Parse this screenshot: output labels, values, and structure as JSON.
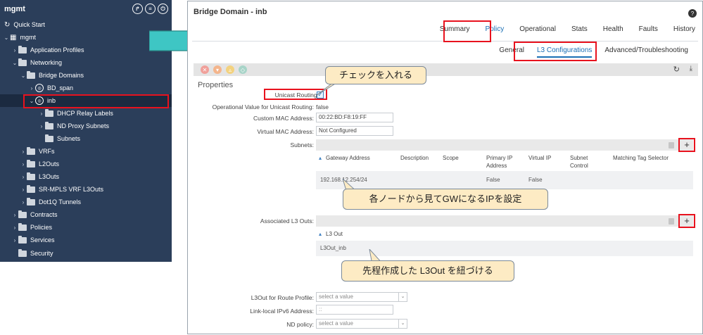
{
  "sidebar": {
    "title": "mgmt",
    "items": [
      {
        "label": "Quick Start"
      },
      {
        "label": "mgmt"
      },
      {
        "label": "Application Profiles"
      },
      {
        "label": "Networking"
      },
      {
        "label": "Bridge Domains"
      },
      {
        "label": "BD_span"
      },
      {
        "label": "inb"
      },
      {
        "label": "DHCP Relay Labels"
      },
      {
        "label": "ND Proxy Subnets"
      },
      {
        "label": "Subnets"
      },
      {
        "label": "VRFs"
      },
      {
        "label": "L2Outs"
      },
      {
        "label": "L3Outs"
      },
      {
        "label": "SR-MPLS VRF L3Outs"
      },
      {
        "label": "Dot1Q Tunnels"
      },
      {
        "label": "Contracts"
      },
      {
        "label": "Policies"
      },
      {
        "label": "Services"
      },
      {
        "label": "Security"
      }
    ]
  },
  "panel": {
    "title": "Bridge Domain - inb",
    "tabs": [
      "Summary",
      "Policy",
      "Operational",
      "Stats",
      "Health",
      "Faults",
      "History"
    ],
    "active_tab": "Policy",
    "subtabs": [
      "General",
      "L3 Configurations",
      "Advanced/Troubleshooting"
    ],
    "active_subtab": "L3 Configurations"
  },
  "properties": {
    "title": "Properties",
    "unicast_routing_label": "Unicast Routing:",
    "op_unicast_label": "Operational Value for Unicast Routing:",
    "op_unicast_value": "false",
    "custom_mac_label": "Custom MAC Address:",
    "custom_mac_value": "00:22:BD:F8:19:FF",
    "virtual_mac_label": "Virtual MAC Address:",
    "virtual_mac_value": "Not Configured",
    "subnets_label": "Subnets:",
    "assoc_l3outs_label": "Associated L3 Outs:",
    "l3out_route_profile_label": "L3Out for Route Profile:",
    "l3out_route_profile_placeholder": "select a value",
    "link_local_label": "Link-local IPv6 Address:",
    "link_local_value": "::",
    "nd_policy_label": "ND policy:",
    "nd_policy_placeholder": "select a value"
  },
  "subnets_table": {
    "headers": [
      "Gateway Address",
      "Description",
      "Scope",
      "Primary IP Address",
      "Virtual IP",
      "Subnet Control",
      "Matching Tag Selector"
    ],
    "rows": [
      {
        "gateway": "192.168.12.254/24",
        "primary": "False",
        "virtual": "False"
      }
    ]
  },
  "l3out_table": {
    "header": "L3 Out",
    "rows": [
      "L3Out_inb"
    ]
  },
  "callouts": {
    "check": "チェックを入れる",
    "gw": "各ノードから見てGWになるIPを設定",
    "l3out": "先程作成した L3Out を紐づける"
  },
  "colors": {
    "sidebar_bg": "#2b3e5a",
    "highlight_red": "#e8121e",
    "accent_blue": "#1a6fb5",
    "callout_bg": "#fdebc4",
    "arrow_teal": "#3ec6c4"
  }
}
